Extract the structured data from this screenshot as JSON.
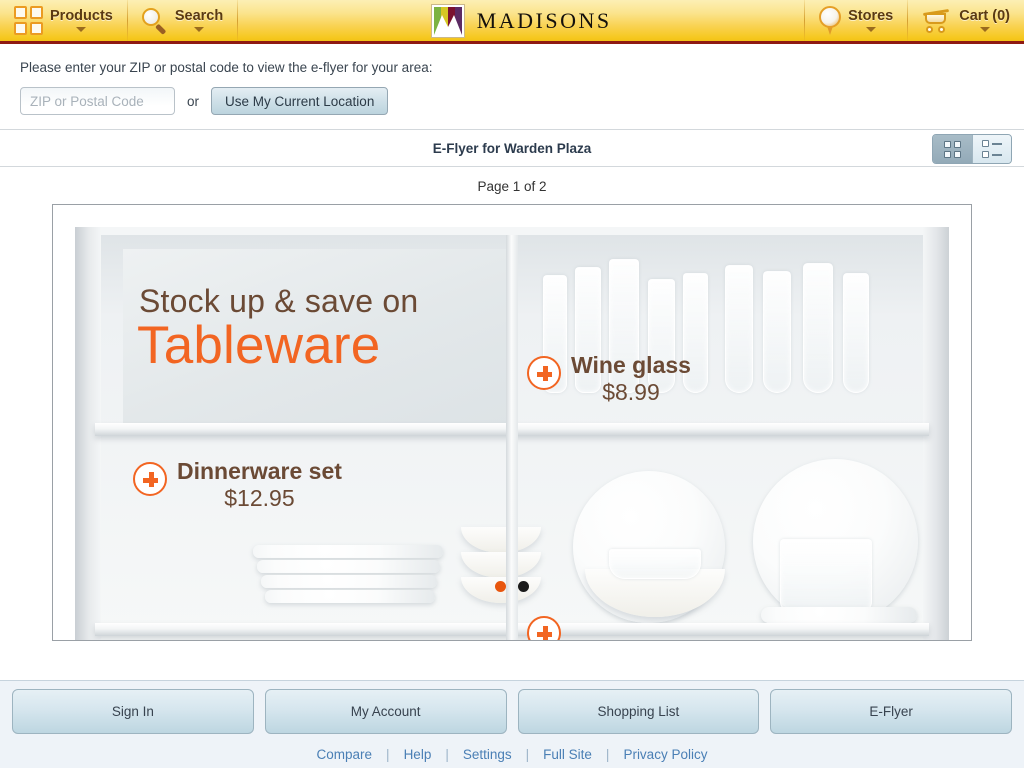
{
  "header": {
    "products": {
      "label": "Products",
      "icon": "grid-icon"
    },
    "search": {
      "label": "Search",
      "icon": "magnifier-icon"
    },
    "brand": "MADISONS",
    "stores": {
      "label": "Stores",
      "icon": "map-pin-icon"
    },
    "cart": {
      "label": "Cart (0)",
      "icon": "shopping-cart-icon"
    }
  },
  "zip": {
    "prompt": "Please enter your ZIP or postal code to view the e-flyer for your area:",
    "input_value": "",
    "placeholder": "ZIP or Postal Code",
    "or_label": "or",
    "location_button": "Use My Current Location"
  },
  "flyer": {
    "title": "E-Flyer for Warden Plaza",
    "view_toggle": {
      "grid": "grid-view",
      "list": "list-view",
      "selected": "grid-view"
    },
    "page_indicator": "Page 1 of 2",
    "headline_top": "Stock up & save on",
    "headline_main": "Tableware",
    "products": [
      {
        "name": "Wine glass",
        "price": "$8.99"
      },
      {
        "name": "Dinnerware set",
        "price": "$12.95"
      }
    ],
    "dots": [
      "active",
      "inactive"
    ]
  },
  "footer": {
    "buttons": [
      "Sign In",
      "My Account",
      "Shopping List",
      "E-Flyer"
    ],
    "links": [
      "Compare",
      "Help",
      "Settings",
      "Full Site",
      "Privacy Policy"
    ],
    "separator": "|"
  },
  "colors": {
    "brand_gold": "#f9d355",
    "brand_red": "#8e1a12",
    "accent_orange": "#f26522",
    "flyer_brown": "#6b4a35",
    "link_blue": "#4a7fb5"
  }
}
